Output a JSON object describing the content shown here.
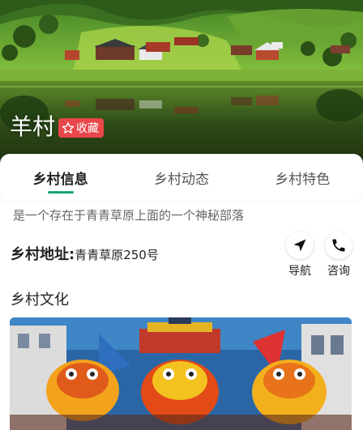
{
  "hero": {
    "village_name": "羊村",
    "favorite_label": "收藏",
    "favorite_icon": "star-outline-icon",
    "scene": "landscape-lake-village"
  },
  "tabs": [
    {
      "label": "乡村信息",
      "active": true
    },
    {
      "label": "乡村动态",
      "active": false
    },
    {
      "label": "乡村特色",
      "active": false
    }
  ],
  "info": {
    "description": "是一个存在于青青草原上面的一个神秘部落",
    "address_label": "乡村地址:",
    "address_value": "青青草原250号",
    "actions": [
      {
        "label": "导航",
        "icon": "navigation-arrow-icon"
      },
      {
        "label": "咨询",
        "icon": "phone-icon"
      }
    ]
  },
  "culture": {
    "title": "乡村文化",
    "image": "lion-dance-photo"
  },
  "colors": {
    "accent": "#1aa37a",
    "favorite_bg": "#e8474b",
    "text_primary": "#222222",
    "text_secondary": "#666666"
  }
}
